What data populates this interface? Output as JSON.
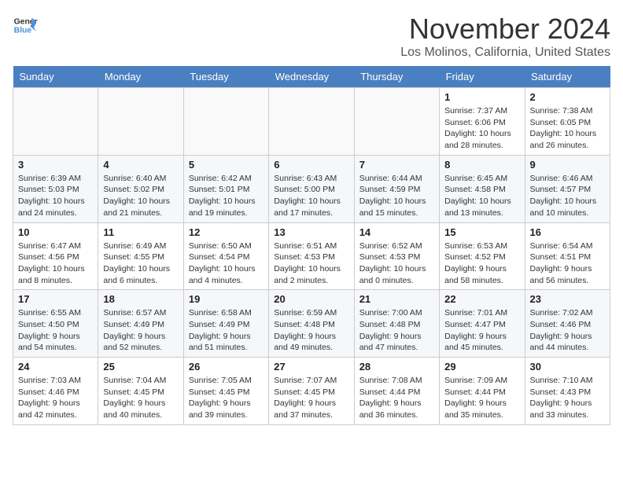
{
  "header": {
    "logo_line1": "General",
    "logo_line2": "Blue",
    "month": "November 2024",
    "location": "Los Molinos, California, United States"
  },
  "days_of_week": [
    "Sunday",
    "Monday",
    "Tuesday",
    "Wednesday",
    "Thursday",
    "Friday",
    "Saturday"
  ],
  "weeks": [
    [
      {
        "day": "",
        "detail": ""
      },
      {
        "day": "",
        "detail": ""
      },
      {
        "day": "",
        "detail": ""
      },
      {
        "day": "",
        "detail": ""
      },
      {
        "day": "",
        "detail": ""
      },
      {
        "day": "1",
        "detail": "Sunrise: 7:37 AM\nSunset: 6:06 PM\nDaylight: 10 hours\nand 28 minutes."
      },
      {
        "day": "2",
        "detail": "Sunrise: 7:38 AM\nSunset: 6:05 PM\nDaylight: 10 hours\nand 26 minutes."
      }
    ],
    [
      {
        "day": "3",
        "detail": "Sunrise: 6:39 AM\nSunset: 5:03 PM\nDaylight: 10 hours\nand 24 minutes."
      },
      {
        "day": "4",
        "detail": "Sunrise: 6:40 AM\nSunset: 5:02 PM\nDaylight: 10 hours\nand 21 minutes."
      },
      {
        "day": "5",
        "detail": "Sunrise: 6:42 AM\nSunset: 5:01 PM\nDaylight: 10 hours\nand 19 minutes."
      },
      {
        "day": "6",
        "detail": "Sunrise: 6:43 AM\nSunset: 5:00 PM\nDaylight: 10 hours\nand 17 minutes."
      },
      {
        "day": "7",
        "detail": "Sunrise: 6:44 AM\nSunset: 4:59 PM\nDaylight: 10 hours\nand 15 minutes."
      },
      {
        "day": "8",
        "detail": "Sunrise: 6:45 AM\nSunset: 4:58 PM\nDaylight: 10 hours\nand 13 minutes."
      },
      {
        "day": "9",
        "detail": "Sunrise: 6:46 AM\nSunset: 4:57 PM\nDaylight: 10 hours\nand 10 minutes."
      }
    ],
    [
      {
        "day": "10",
        "detail": "Sunrise: 6:47 AM\nSunset: 4:56 PM\nDaylight: 10 hours\nand 8 minutes."
      },
      {
        "day": "11",
        "detail": "Sunrise: 6:49 AM\nSunset: 4:55 PM\nDaylight: 10 hours\nand 6 minutes."
      },
      {
        "day": "12",
        "detail": "Sunrise: 6:50 AM\nSunset: 4:54 PM\nDaylight: 10 hours\nand 4 minutes."
      },
      {
        "day": "13",
        "detail": "Sunrise: 6:51 AM\nSunset: 4:53 PM\nDaylight: 10 hours\nand 2 minutes."
      },
      {
        "day": "14",
        "detail": "Sunrise: 6:52 AM\nSunset: 4:53 PM\nDaylight: 10 hours\nand 0 minutes."
      },
      {
        "day": "15",
        "detail": "Sunrise: 6:53 AM\nSunset: 4:52 PM\nDaylight: 9 hours\nand 58 minutes."
      },
      {
        "day": "16",
        "detail": "Sunrise: 6:54 AM\nSunset: 4:51 PM\nDaylight: 9 hours\nand 56 minutes."
      }
    ],
    [
      {
        "day": "17",
        "detail": "Sunrise: 6:55 AM\nSunset: 4:50 PM\nDaylight: 9 hours\nand 54 minutes."
      },
      {
        "day": "18",
        "detail": "Sunrise: 6:57 AM\nSunset: 4:49 PM\nDaylight: 9 hours\nand 52 minutes."
      },
      {
        "day": "19",
        "detail": "Sunrise: 6:58 AM\nSunset: 4:49 PM\nDaylight: 9 hours\nand 51 minutes."
      },
      {
        "day": "20",
        "detail": "Sunrise: 6:59 AM\nSunset: 4:48 PM\nDaylight: 9 hours\nand 49 minutes."
      },
      {
        "day": "21",
        "detail": "Sunrise: 7:00 AM\nSunset: 4:48 PM\nDaylight: 9 hours\nand 47 minutes."
      },
      {
        "day": "22",
        "detail": "Sunrise: 7:01 AM\nSunset: 4:47 PM\nDaylight: 9 hours\nand 45 minutes."
      },
      {
        "day": "23",
        "detail": "Sunrise: 7:02 AM\nSunset: 4:46 PM\nDaylight: 9 hours\nand 44 minutes."
      }
    ],
    [
      {
        "day": "24",
        "detail": "Sunrise: 7:03 AM\nSunset: 4:46 PM\nDaylight: 9 hours\nand 42 minutes."
      },
      {
        "day": "25",
        "detail": "Sunrise: 7:04 AM\nSunset: 4:45 PM\nDaylight: 9 hours\nand 40 minutes."
      },
      {
        "day": "26",
        "detail": "Sunrise: 7:05 AM\nSunset: 4:45 PM\nDaylight: 9 hours\nand 39 minutes."
      },
      {
        "day": "27",
        "detail": "Sunrise: 7:07 AM\nSunset: 4:45 PM\nDaylight: 9 hours\nand 37 minutes."
      },
      {
        "day": "28",
        "detail": "Sunrise: 7:08 AM\nSunset: 4:44 PM\nDaylight: 9 hours\nand 36 minutes."
      },
      {
        "day": "29",
        "detail": "Sunrise: 7:09 AM\nSunset: 4:44 PM\nDaylight: 9 hours\nand 35 minutes."
      },
      {
        "day": "30",
        "detail": "Sunrise: 7:10 AM\nSunset: 4:43 PM\nDaylight: 9 hours\nand 33 minutes."
      }
    ]
  ]
}
